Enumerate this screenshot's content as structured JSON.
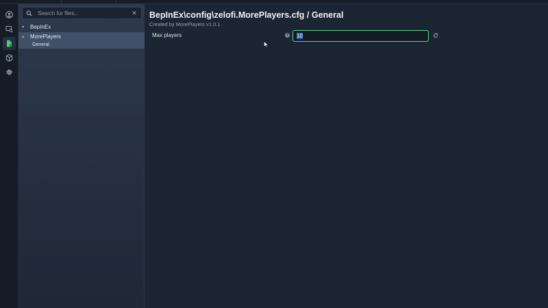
{
  "tabs_strip": {
    "label": ""
  },
  "rail": {
    "items": [
      {
        "icon": "profile-icon",
        "active": false
      },
      {
        "icon": "image-search-icon",
        "active": false
      },
      {
        "icon": "config-file-icon",
        "active": true
      },
      {
        "icon": "package-icon",
        "active": false
      },
      {
        "icon": "gear-icon",
        "active": false
      }
    ],
    "active_color": "#4ccf7d"
  },
  "search": {
    "placeholder": "Search for files...",
    "value": "",
    "clear_label": "✕"
  },
  "tree": {
    "items": [
      {
        "label": "BepInEx",
        "level": 0,
        "chevron": "▾"
      },
      {
        "label": "MorePlayers",
        "level": 0,
        "chevron": "▴"
      },
      {
        "label": "General",
        "level": 1
      }
    ]
  },
  "main": {
    "title": "BepInEx\\config\\zelofi.MorePlayers.cfg / General",
    "subtitle": "Created by MorePlayers v1.0.1",
    "settings": [
      {
        "label": "Max players",
        "help": "?",
        "value": "10"
      }
    ]
  },
  "colors": {
    "accent": "#5bd88d",
    "selection": "#2b63c2",
    "background": "#1c2534"
  }
}
